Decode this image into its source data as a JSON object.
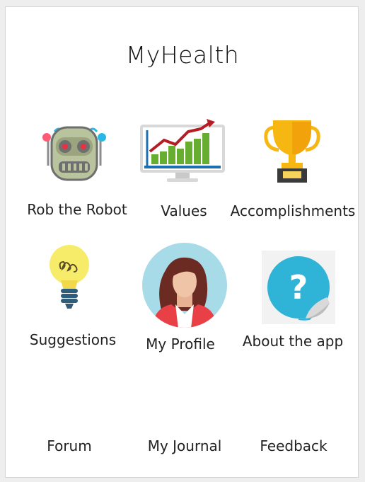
{
  "app": {
    "title": "MyHealth"
  },
  "tiles": {
    "robot": {
      "label": "Rob the Robot",
      "icon": "robot-icon"
    },
    "values": {
      "label": "Values",
      "icon": "chart-monitor-icon"
    },
    "accomplishments": {
      "label": "Accomplishments",
      "icon": "trophy-icon"
    },
    "suggestions": {
      "label": "Suggestions",
      "icon": "lightbulb-icon"
    },
    "profile": {
      "label": "My Profile",
      "icon": "woman-avatar-icon"
    },
    "about": {
      "label": "About the app",
      "icon": "question-sticker-icon"
    },
    "forum": {
      "label": "Forum"
    },
    "journal": {
      "label": "My Journal"
    },
    "feedback": {
      "label": "Feedback"
    }
  },
  "colors": {
    "robot_body": "#b9c39e",
    "robot_eye": "#e5333f",
    "chart_bar": "#67ad2f",
    "chart_arrow": "#b51d24",
    "trophy_gold": "#f7b712",
    "bulb_yellow": "#f7ec6a",
    "avatar_bg": "#a8dbe8",
    "question_blue": "#2fb3d6"
  }
}
